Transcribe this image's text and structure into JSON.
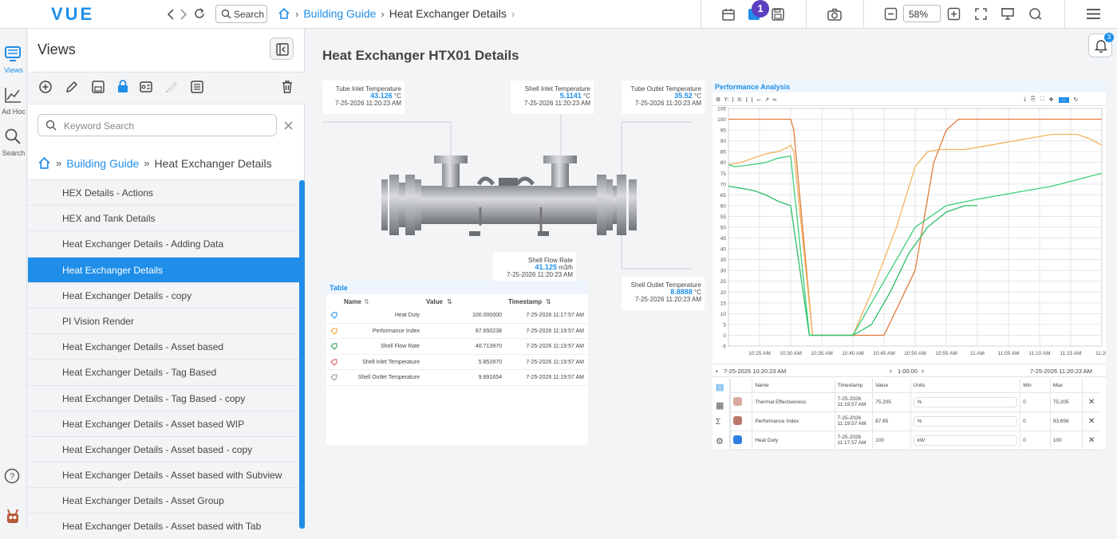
{
  "app": {
    "logo": "VUE"
  },
  "topbar": {
    "search_label": "Search",
    "breadcrumb": [
      "Building Guide",
      "Heat Exchanger Details"
    ],
    "notification_count": "1",
    "zoom": "58%"
  },
  "rail": {
    "views": "Views",
    "adhoc": "Ad Hoc",
    "search": "Search"
  },
  "views_panel": {
    "title": "Views",
    "search_placeholder": "Keyword Search",
    "breadcrumb": [
      "Building Guide",
      "Heat Exchanger Details"
    ],
    "items": [
      "HEX Details - Actions",
      "HEX and Tank Details",
      "Heat Exchanger Details - Adding Data",
      "Heat Exchanger Details",
      "Heat Exchanger Details - copy",
      "PI Vision Render",
      "Heat Exchanger Details - Asset based",
      "Heat Exchanger Details - Tag Based",
      "Heat Exchanger Details - Tag Based - copy",
      "Heat Exchanger Details - Asset based WIP",
      "Heat Exchanger Details - Asset based - copy",
      "Heat Exchanger Details - Asset based with Subview",
      "Heat Exchanger Details - Asset Group",
      "Heat Exchanger Details - Asset based with Tab"
    ],
    "selected_index": 3
  },
  "main": {
    "title": "Heat Exchanger HTX01 Details",
    "bell_badge": "3",
    "cards": {
      "tube_inlet": {
        "label": "Tube Inlet Temperature",
        "value": "43.126",
        "unit": "°C",
        "time": "7-25-2026 11:20:23 AM"
      },
      "shell_inlet": {
        "label": "Shell Inlet Temperature",
        "value": "5.1141",
        "unit": "°C",
        "time": "7-25-2026 11:20:23 AM"
      },
      "tube_outlet": {
        "label": "Tube Outlet Temperature",
        "value": "35.52",
        "unit": "°C",
        "time": "7-25-2026 11:20:23 AM"
      },
      "shell_flow": {
        "label": "Shell Flow Rate",
        "value": "41.125",
        "unit": "m3/h",
        "time": "7-25-2026 11:20:23 AM"
      },
      "shell_outlet": {
        "label": "Shell Outlet Temperature",
        "value": "8.8888",
        "unit": "°C",
        "time": "7-25-2026 11:20:23 AM"
      }
    },
    "table": {
      "title": "Table",
      "headers": {
        "name": "Name",
        "value": "Value",
        "timestamp": "Timestamp"
      },
      "rows": [
        {
          "name": "Heat Duty",
          "value": "100.000000",
          "ts": "7-25-2026 11:17:57 AM",
          "color": "#1f8ee8"
        },
        {
          "name": "Performance Index",
          "value": "87.650238",
          "ts": "7-25-2026 11:19:57 AM",
          "color": "#f0a030"
        },
        {
          "name": "Shell Flow Rate",
          "value": "40.713970",
          "ts": "7-25-2026 11:19:57 AM",
          "color": "#2e9e4a"
        },
        {
          "name": "Shell Inlet Temperature",
          "value": "5.852870",
          "ts": "7-25-2026 11:19:57 AM",
          "color": "#d9534f"
        },
        {
          "name": "Shell Outlet Temperature",
          "value": "9.891654",
          "ts": "7-25-2026 11:19:57 AM",
          "color": "#8a96a3"
        }
      ]
    }
  },
  "performance": {
    "title": "Performance Analysis",
    "toolbar": {
      "y": "Y:",
      "x": "X:"
    },
    "range_start": "7-25-2026 10:20:23 AM",
    "range_end": "7-25-2026 11:20:23 AM",
    "duration": "1:00:00",
    "legend_headers": {
      "name": "Name",
      "timestamp": "Timestamp",
      "value": "Value",
      "units": "Units",
      "min": "Min",
      "max": "Max"
    },
    "legend_rows": [
      {
        "name": "Thermal Effectiveness",
        "ts1": "7-25-2026",
        "ts2": "11:19:57 AM",
        "value": "75.205",
        "units": "%",
        "min": "0",
        "max": "75.205",
        "swatch": "#d9a8a0"
      },
      {
        "name": "Performance Index",
        "ts1": "7-25-2026",
        "ts2": "11:19:57 AM",
        "value": "87.65",
        "units": "%",
        "min": "0",
        "max": "93.656",
        "swatch": "#b9786a"
      },
      {
        "name": "Heat Duty",
        "ts1": "7-25-2026",
        "ts2": "11:17:57 AM",
        "value": "100",
        "units": "kW",
        "min": "0",
        "max": "100",
        "swatch": "#2f7fe0"
      }
    ],
    "colors": {
      "heat_duty": "#e07b3c",
      "performance": "#f3b35c",
      "thermal": "#3ccf7a",
      "thermal2": "#2cbf6a"
    }
  },
  "chart_data": {
    "type": "line",
    "title": "Performance Analysis",
    "ylim": [
      -5,
      105
    ],
    "yticks": [
      105,
      100,
      95,
      90,
      85,
      80,
      75,
      70,
      65,
      60,
      55,
      50,
      45,
      40,
      35,
      30,
      25,
      20,
      15,
      10,
      5,
      0,
      -5
    ],
    "xticks": [
      "10:25 AM",
      "10:30 AM",
      "10:35 AM",
      "10:40 AM",
      "10:45 AM",
      "10:50 AM",
      "10:55 AM",
      "11 AM",
      "11:05 AM",
      "11:10 AM",
      "11:15 AM",
      "11:20"
    ],
    "x_minutes_range": [
      20,
      80
    ],
    "series": [
      {
        "key": "heat_duty",
        "x": [
          20,
          30,
          30.5,
          33.5,
          45,
          50,
          53,
          55,
          57,
          60,
          80
        ],
        "y": [
          100,
          100,
          95,
          0,
          0,
          30,
          80,
          95,
          100,
          100,
          100
        ]
      },
      {
        "key": "performance",
        "x": [
          20,
          22,
          24,
          26,
          28,
          29.5,
          30,
          30.5,
          33.5,
          40,
          43,
          47,
          50,
          52,
          54,
          56,
          58,
          60,
          64,
          68,
          72,
          76,
          78,
          80
        ],
        "y": [
          79,
          80,
          82,
          84,
          85,
          87,
          88,
          85,
          0,
          0,
          20,
          50,
          78,
          85,
          86,
          86,
          86,
          87,
          89,
          91,
          93,
          93,
          91,
          88
        ]
      },
      {
        "key": "thermal",
        "x": [
          20,
          21,
          24,
          26,
          28,
          30,
          33,
          40,
          43,
          46,
          50,
          55,
          60,
          64,
          68,
          72,
          76,
          80
        ],
        "y": [
          79,
          78,
          79,
          80,
          82,
          83,
          0,
          0,
          15,
          30,
          50,
          60,
          63,
          65,
          67,
          69,
          72,
          75
        ]
      },
      {
        "key": "thermal2",
        "x": [
          20,
          22,
          24,
          26,
          28,
          30,
          33,
          40,
          43,
          46,
          49,
          52,
          55,
          58,
          60
        ],
        "y": [
          69,
          68,
          67,
          65,
          62,
          60,
          0,
          0,
          5,
          20,
          38,
          50,
          57,
          60,
          60
        ]
      }
    ]
  }
}
